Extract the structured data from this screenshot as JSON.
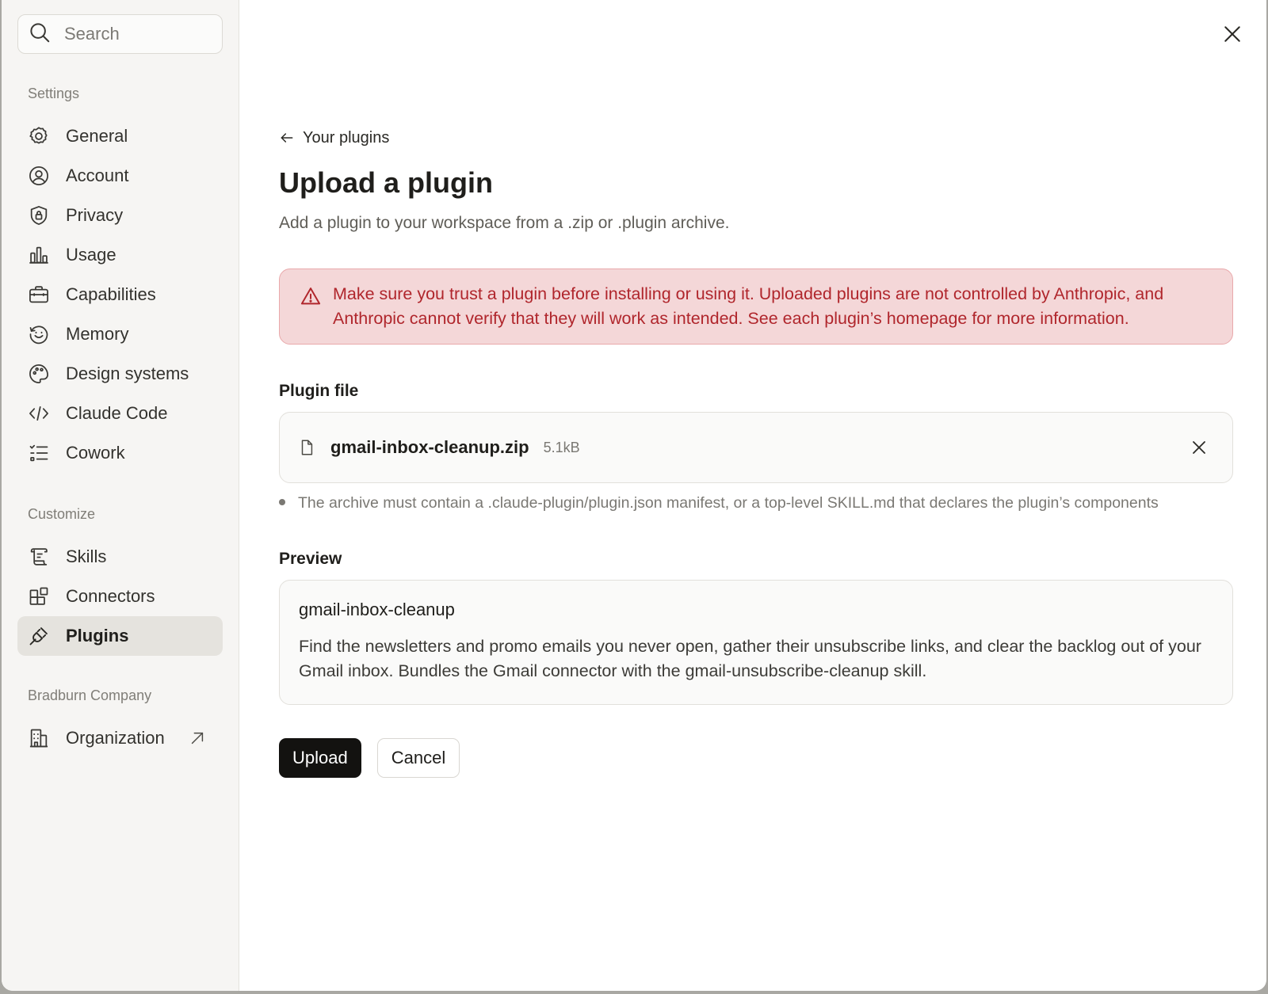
{
  "colors": {
    "warning_bg": "#f4d7d8",
    "warning_text": "#b0262c",
    "primary_button": "#131210",
    "active_nav_bg": "#e5e3de"
  },
  "sidebar": {
    "search": {
      "placeholder": "Search",
      "icon": "search-icon"
    },
    "settings_label": "Settings",
    "settings_items": [
      {
        "label": "General",
        "icon": "gear-icon"
      },
      {
        "label": "Account",
        "icon": "user-circle-icon"
      },
      {
        "label": "Privacy",
        "icon": "shield-lock-icon"
      },
      {
        "label": "Usage",
        "icon": "bar-chart-icon"
      },
      {
        "label": "Capabilities",
        "icon": "briefcase-icon"
      },
      {
        "label": "Memory",
        "icon": "memory-icon"
      },
      {
        "label": "Design systems",
        "icon": "palette-icon"
      },
      {
        "label": "Claude Code",
        "icon": "code-icon"
      },
      {
        "label": "Cowork",
        "icon": "list-icon"
      }
    ],
    "customize_label": "Customize",
    "customize_items": [
      {
        "label": "Skills",
        "icon": "scroll-icon"
      },
      {
        "label": "Connectors",
        "icon": "blocks-icon"
      },
      {
        "label": "Plugins",
        "icon": "plug-icon",
        "active": true
      }
    ],
    "org_label": "Bradburn Company",
    "org_items": [
      {
        "label": "Organization",
        "icon": "building-icon",
        "external_icon": "arrow-up-right-icon"
      }
    ]
  },
  "main": {
    "back_link": "Your plugins",
    "title": "Upload a plugin",
    "subtitle": "Add a plugin to your workspace from a .zip or .plugin archive.",
    "warning": "Make sure you trust a plugin before installing or using it. Uploaded plugins are not controlled by Anthropic, and Anthropic cannot verify that they will work as intended. See each plugin’s homepage for more information.",
    "plugin_file": {
      "label": "Plugin file",
      "file_name": "gmail-inbox-cleanup.zip",
      "file_size": "5.1kB",
      "hint": "The archive must contain a .claude-plugin/plugin.json manifest, or a top-level SKILL.md that declares the plugin’s components"
    },
    "preview": {
      "label": "Preview",
      "name": "gmail-inbox-cleanup",
      "description": "Find the newsletters and promo emails you never open, gather their unsubscribe links, and clear the backlog out of your Gmail inbox. Bundles the Gmail connector with the gmail-unsubscribe-cleanup skill."
    },
    "actions": {
      "upload": "Upload",
      "cancel": "Cancel"
    }
  }
}
